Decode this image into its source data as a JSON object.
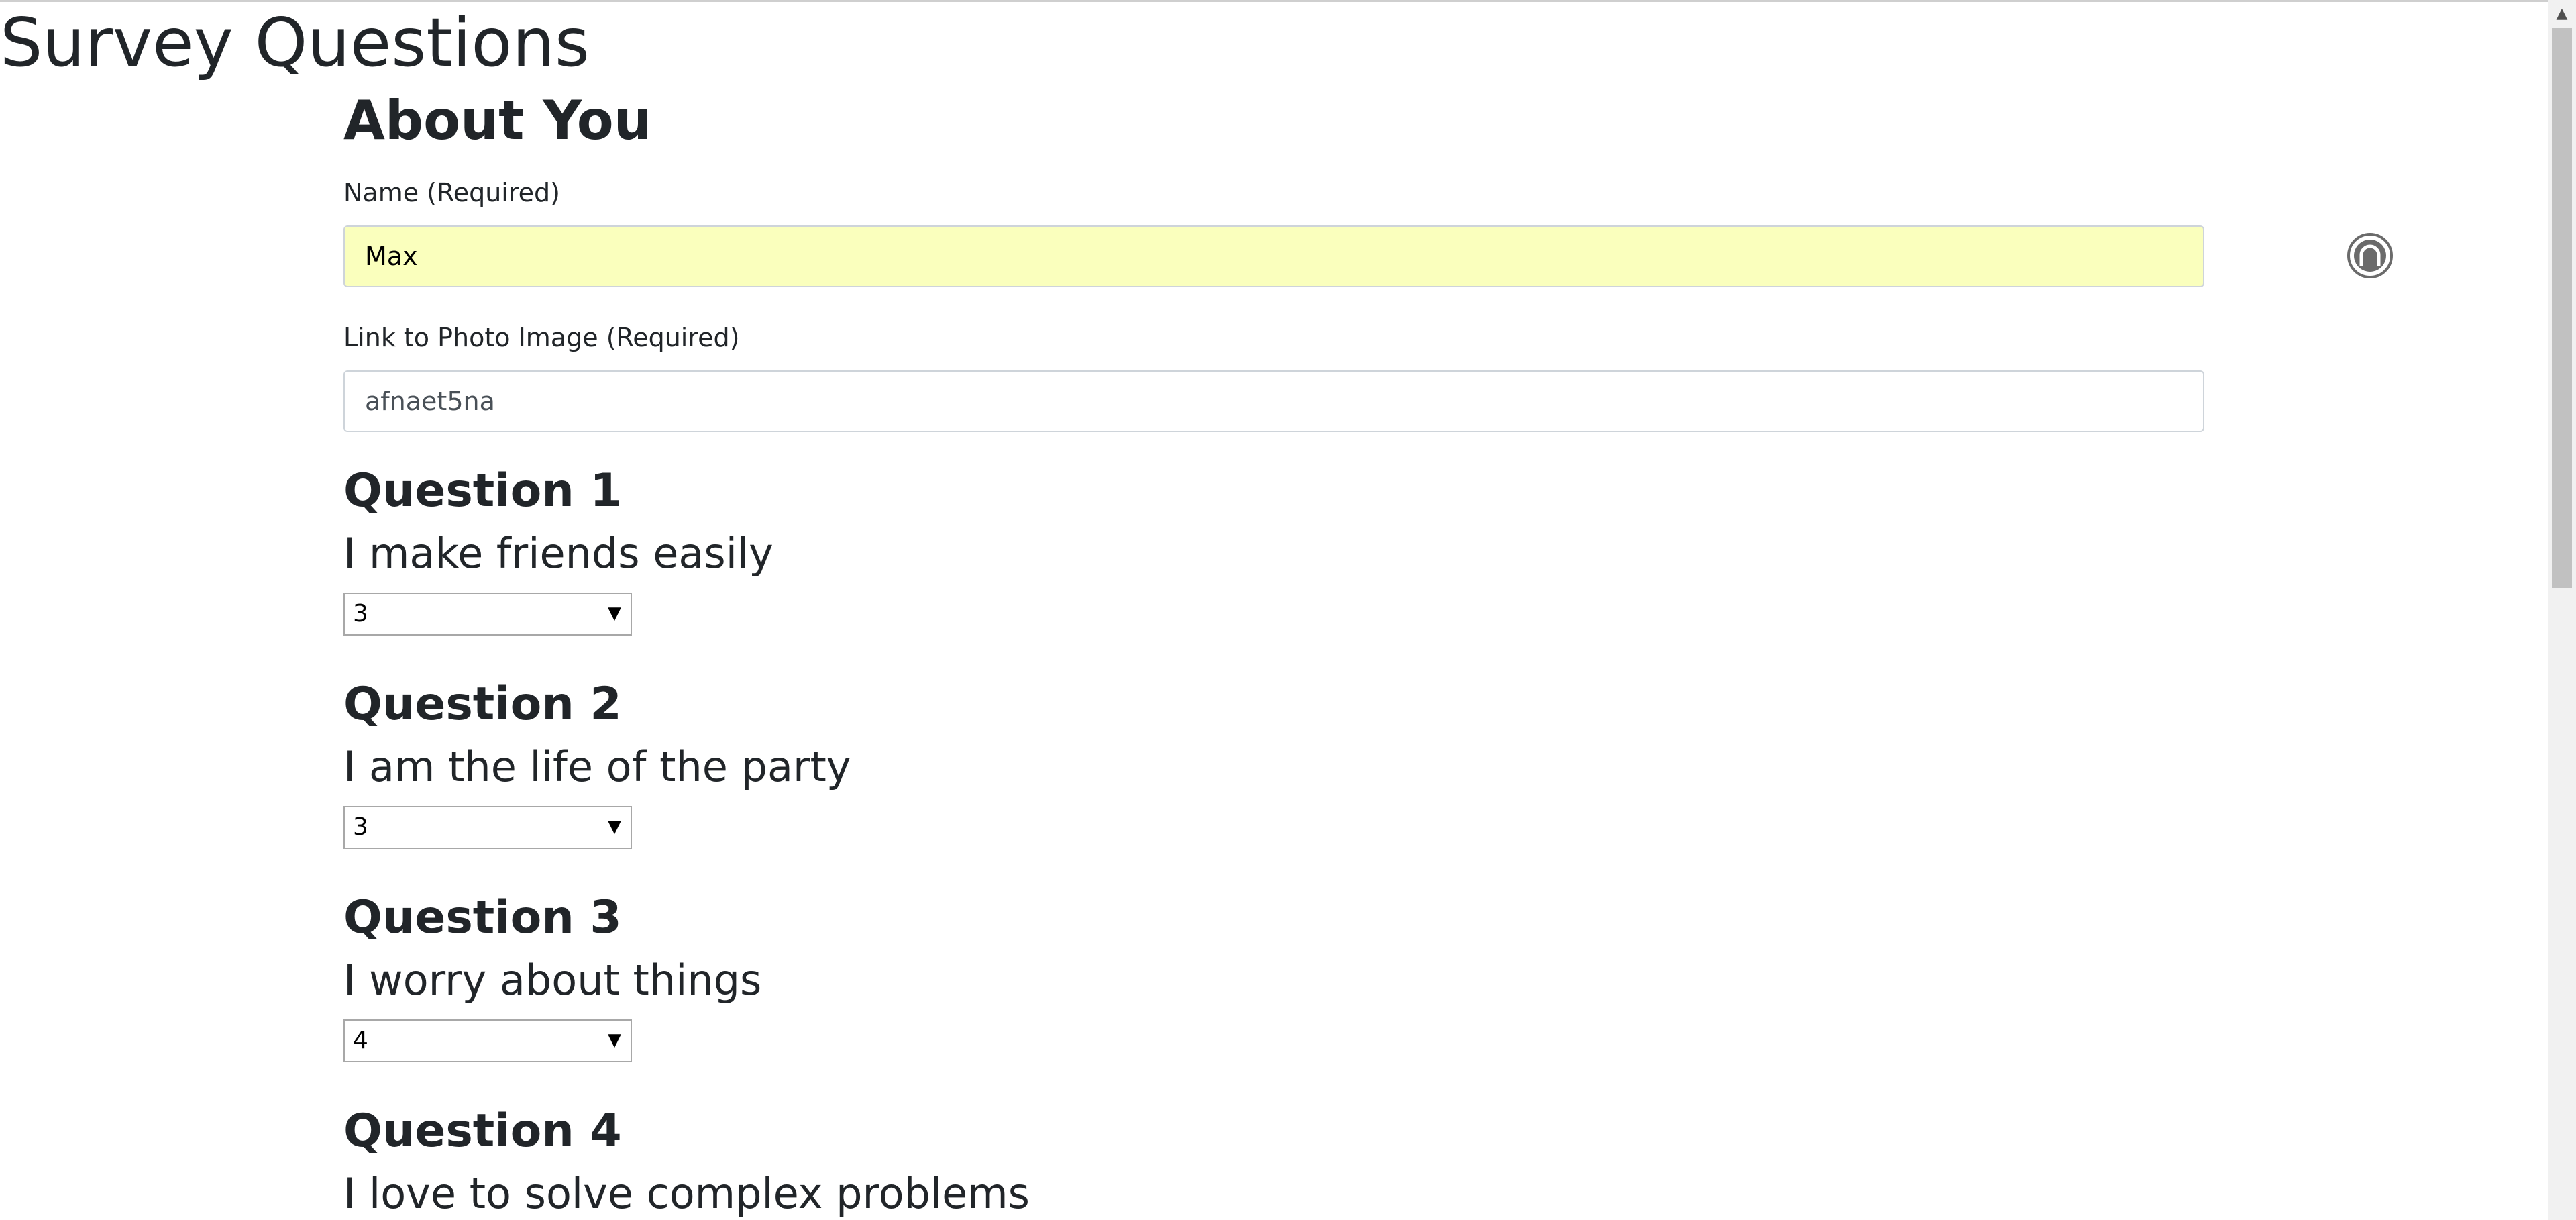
{
  "page": {
    "title": "Survey Questions"
  },
  "about": {
    "heading": "About You",
    "name_label": "Name (Required)",
    "name_value": "Max",
    "photo_label": "Link to Photo Image (Required)",
    "photo_value": "afnaet5na",
    "autofill_icon": "password-manager-icon"
  },
  "questions": [
    {
      "title": "Question 1",
      "text": "I make friends easily",
      "selected": "3"
    },
    {
      "title": "Question 2",
      "text": "I am the life of the party",
      "selected": "3"
    },
    {
      "title": "Question 3",
      "text": "I worry about things",
      "selected": "4"
    },
    {
      "title": "Question 4",
      "text": "I love to solve complex problems"
    }
  ],
  "select_arrow": "▼",
  "colors": {
    "autofill_background": "#faffbd",
    "text": "#212529"
  }
}
